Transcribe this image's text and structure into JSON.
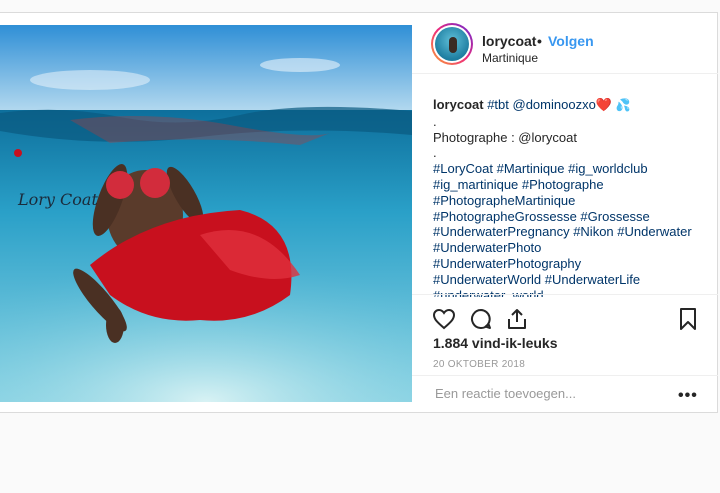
{
  "post": {
    "username": "lorycoat",
    "separator": "•",
    "follow_label": "Volgen",
    "location": "Martinique",
    "photo_watermark": "Lory Coat",
    "caption": {
      "username": "lorycoat",
      "line1_text": "#tbt @dominoozxo",
      "heart": "❤️",
      "drops": "💦",
      "dot1": ".",
      "photographer": "Photographe : @lorycoat",
      "dot2": ".",
      "tags": [
        "#LoryCoat #Martinique #ig_worldclub",
        "#ig_martinique #Photographe",
        "#PhotographeMartinique",
        "#PhotographeGrossesse #Grossesse",
        "#UnderwaterPregnancy #Nikon #Underwater",
        "#UnderwaterPhoto",
        "#UnderwaterPhotography",
        "#UnderwaterWorld #UnderwaterLife",
        "#underwater_world"
      ]
    },
    "likes": "1.884 vind-ik-leuks",
    "date": "20 OKTOBER 2018",
    "comment_placeholder": "Een reactie toevoegen...",
    "more_label": "•••",
    "icons": {
      "like": "heart-icon",
      "comment": "comment-icon",
      "share": "share-icon",
      "save": "bookmark-icon",
      "more": "more-options-icon"
    },
    "colors": {
      "link": "#3897f0",
      "hashtag": "#003569",
      "border": "#dbdbdb"
    }
  }
}
